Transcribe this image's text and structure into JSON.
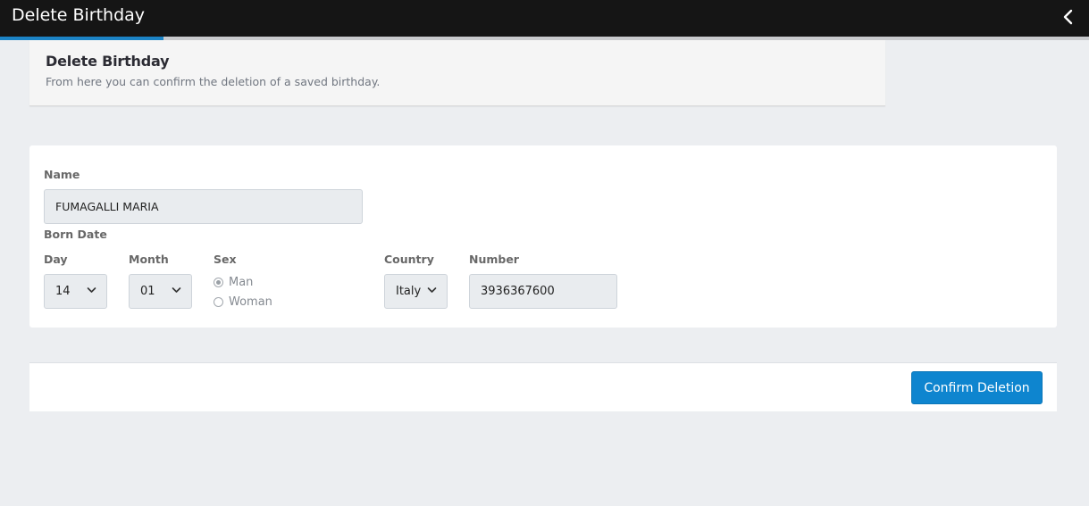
{
  "topbar": {
    "title": "Delete Birthday",
    "progress_fraction": 0.15
  },
  "header": {
    "title": "Delete Birthday",
    "subtitle": "From here you can confirm the deletion of a saved birthday."
  },
  "form": {
    "name_label": "Name",
    "name_value": "FUMAGALLI MARIA",
    "born_date_label": "Born Date",
    "day_label": "Day",
    "day_value": "14",
    "month_label": "Month",
    "month_value": "01",
    "sex_label": "Sex",
    "sex_options": [
      "Man",
      "Woman"
    ],
    "sex_selected": "Man",
    "country_label": "Country",
    "country_value": "Italy",
    "number_label": "Number",
    "number_value": "3936367600"
  },
  "footer": {
    "confirm_label": "Confirm Deletion"
  },
  "colors": {
    "topbar_bg": "#151515",
    "accent": "#1c84c6",
    "button": "#0e85cf",
    "page_bg": "#eceef1"
  }
}
